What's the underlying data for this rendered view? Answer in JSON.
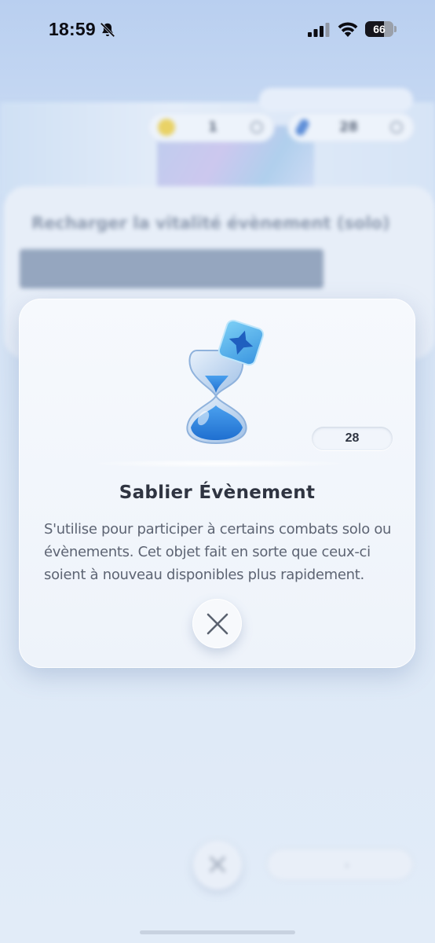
{
  "status_bar": {
    "time": "18:59",
    "battery_percent": "66",
    "battery_level": 0.66,
    "icons": [
      "bell-slash-icon",
      "signal-icon",
      "wifi-icon",
      "battery-icon"
    ]
  },
  "background": {
    "currency_left_value": "1",
    "currency_right_value": "28",
    "panel_title": "Recharger la vitalité évènement (solo)",
    "panel_bar_caption": "",
    "panel_bar_value": "",
    "manual_button_label": ""
  },
  "modal": {
    "item_title": "Sablier Évènement",
    "item_count": "28",
    "item_description": "S'utilise pour participer à certains combats solo ou évènements. Cet objet fait en sorte que ceux-ci soient à nouveau disponibles plus rapidement.",
    "item_icon": "hourglass-icon",
    "close_icon": "close-icon"
  },
  "colors": {
    "accent_blue": "#3d8be0",
    "title_text": "#2f3441",
    "body_text": "#5d6473"
  }
}
